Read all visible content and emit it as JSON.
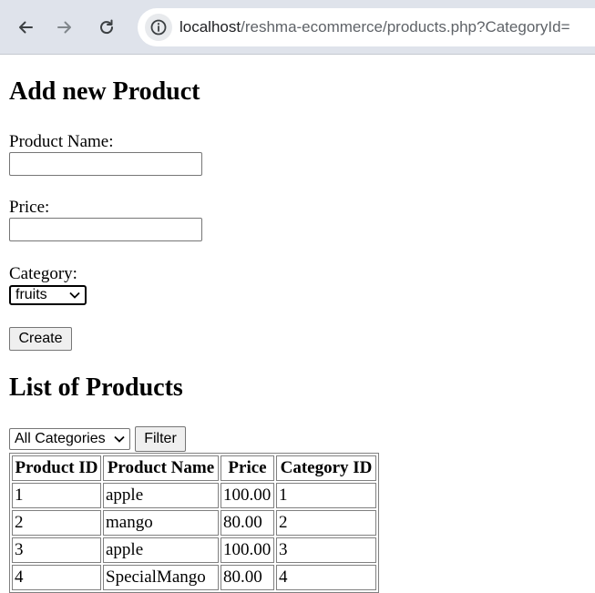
{
  "browser": {
    "url_host": "localhost",
    "url_path": "/reshma-ecommerce/products.php?CategoryId="
  },
  "add_form": {
    "heading": "Add new Product",
    "name_label": "Product Name:",
    "name_value": "",
    "price_label": "Price:",
    "price_value": "",
    "category_label": "Category:",
    "category_selected": "fruits",
    "create_label": "Create"
  },
  "list": {
    "heading": "List of Products",
    "filter_selected": "All Categories",
    "filter_button": "Filter",
    "columns": [
      "Product ID",
      "Product Name",
      "Price",
      "Category ID"
    ],
    "rows": [
      [
        "1",
        "apple",
        "100.00",
        "1"
      ],
      [
        "2",
        "mango",
        "80.00",
        "2"
      ],
      [
        "3",
        "apple",
        "100.00",
        "3"
      ],
      [
        "4",
        "SpecialMango",
        "80.00",
        "4"
      ]
    ]
  },
  "icons": {
    "back": "back-arrow-icon",
    "forward": "forward-arrow-icon",
    "reload": "reload-icon",
    "site_info": "info-icon",
    "dropdown": "chevron-down-icon"
  }
}
